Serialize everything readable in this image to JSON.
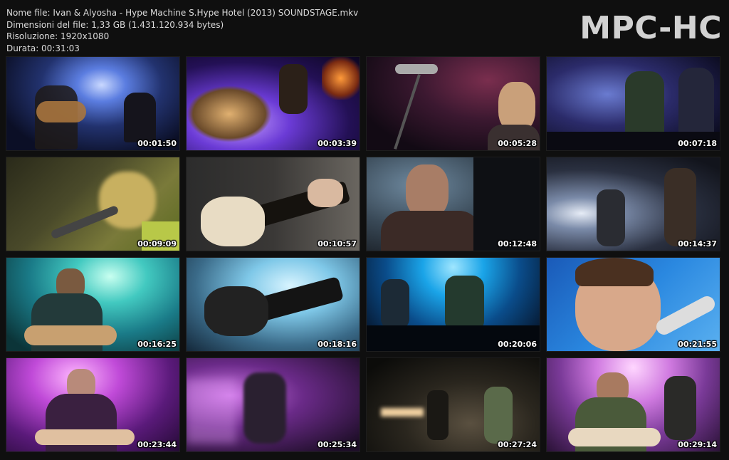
{
  "file_info": {
    "name": "Nome file: Ivan & Alyosha - Hype Machine S.Hype Hotel (2013) SOUNDSTAGE.mkv",
    "size": "Dimensioni del file: 1,33 GB (1.431.120.934 bytes)",
    "resolution": "Risoluzione: 1920x1080",
    "duration": "Durata: 00:31:03"
  },
  "logo": "MPC-HC",
  "thumbnails": [
    {
      "timestamp": "00:01:50"
    },
    {
      "timestamp": "00:03:39"
    },
    {
      "timestamp": "00:05:28"
    },
    {
      "timestamp": "00:07:18"
    },
    {
      "timestamp": "00:09:09"
    },
    {
      "timestamp": "00:10:57"
    },
    {
      "timestamp": "00:12:48"
    },
    {
      "timestamp": "00:14:37"
    },
    {
      "timestamp": "00:16:25"
    },
    {
      "timestamp": "00:18:16"
    },
    {
      "timestamp": "00:20:06"
    },
    {
      "timestamp": "00:21:55"
    },
    {
      "timestamp": "00:23:44"
    },
    {
      "timestamp": "00:25:34"
    },
    {
      "timestamp": "00:27:24"
    },
    {
      "timestamp": "00:29:14"
    }
  ]
}
